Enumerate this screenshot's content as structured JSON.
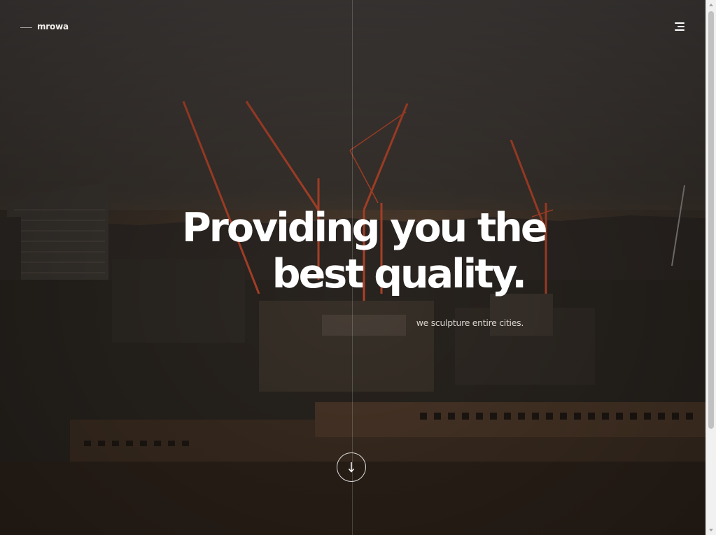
{
  "header": {
    "logo_text": "mrowa",
    "menu_icon": "menu-lines-icon"
  },
  "hero": {
    "headline_line1": "Providing you the",
    "headline_line2": "best quality.",
    "subtitle": "we sculpture entire cities.",
    "scroll_icon": "arrow-down-icon",
    "background_image": "city-skyline-with-construction-cranes"
  },
  "colors": {
    "text": "#ffffff",
    "crane": "#b5452a",
    "overlay": "#1c1915"
  }
}
